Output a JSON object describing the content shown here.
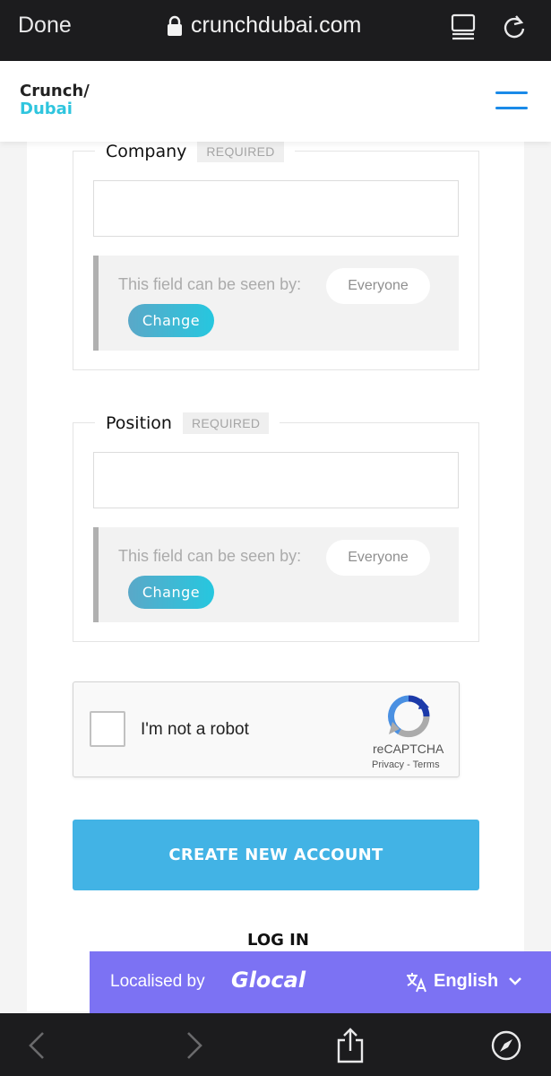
{
  "browser": {
    "done_label": "Done",
    "url": "crunchdubai.com",
    "icons": [
      "lock-icon",
      "reader-view-icon",
      "reload-icon"
    ],
    "bottom_icons": [
      "back-arrow-icon",
      "forward-arrow-icon",
      "share-icon",
      "compass-icon"
    ]
  },
  "header": {
    "logo_line1": "Crunch/",
    "logo_line2": "Dubai",
    "menu_icon": "hamburger-menu-icon",
    "accent_color": "#2fc5de"
  },
  "fields": [
    {
      "label": "Company",
      "badge": "REQUIRED",
      "value": "",
      "visibility_text": "This field can be seen by:",
      "visibility_value": "Everyone",
      "change_label": "Change"
    },
    {
      "label": "Position",
      "badge": "REQUIRED",
      "value": "",
      "visibility_text": "This field can be seen by:",
      "visibility_value": "Everyone",
      "change_label": "Change"
    }
  ],
  "captcha": {
    "label": "I'm not a robot",
    "brand": "reCAPTCHA",
    "privacy": "Privacy",
    "separator": "-",
    "terms": "Terms",
    "checked": false
  },
  "actions": {
    "create_label": "CREATE NEW ACCOUNT",
    "login_label": "LOG IN",
    "primary_color": "#42b3e5"
  },
  "localisation": {
    "prefix": "Localised by",
    "brand": "Glocal",
    "language": "English",
    "bar_color": "#7c72f3"
  }
}
